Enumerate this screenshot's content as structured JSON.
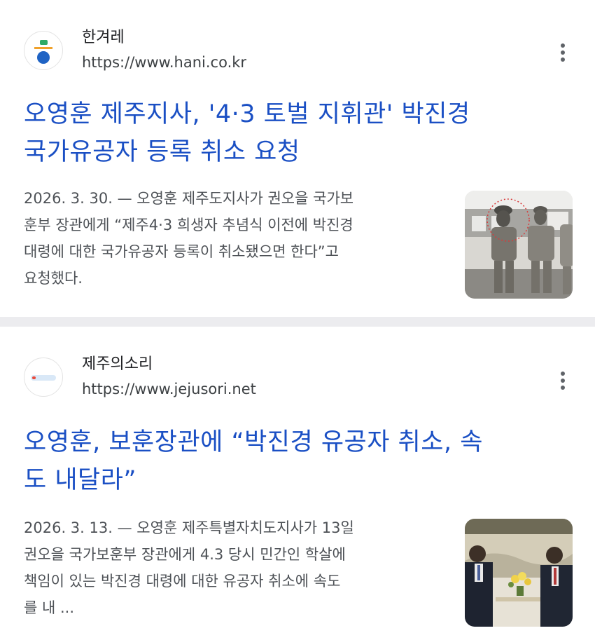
{
  "results": [
    {
      "source_name": "한겨레",
      "url": "https://www.hani.co.kr",
      "headline_line1": "오영훈 제주지사, '4·3 토벌 지휘관' 박진경",
      "headline_line2": "국가유공자 등록 취소 요청",
      "snippet_line1": "2026. 3. 30. — 오영훈 제주도지사가 권오을 국가보",
      "snippet_line2": "훈부 장관에게 “제주4·3 희생자 추념식 이전에 박진경",
      "snippet_line3": "대령에 대한 국가유공자 등록이 취소됐으면 한다”고",
      "snippet_line4": "요청했다.",
      "favicon_icon": "hani-logo-icon",
      "thumbnail": "old-military-photo"
    },
    {
      "source_name": "제주의소리",
      "url": "https://www.jejusori.net",
      "headline_line1": "오영훈, 보훈장관에 “박진경 유공자 취소, 속",
      "headline_line2": "도 내달라”",
      "snippet_line1": "2026. 3. 13. — 오영훈 제주특별자치도지사가 13일",
      "snippet_line2": "권오을 국가보훈부 장관에게 4.3 당시 민간인 학살에",
      "snippet_line3": "책임이 있는 박진경 대령에 대한 유공자 취소에 속도",
      "snippet_line4": "를 내 ...",
      "favicon_icon": "jejusori-logo-icon",
      "thumbnail": "meeting-photo"
    }
  ],
  "colors": {
    "headline": "#1a4fc4",
    "snippet": "#4d5156",
    "divider": "#ececef"
  },
  "more_icon": "more-vert-icon"
}
